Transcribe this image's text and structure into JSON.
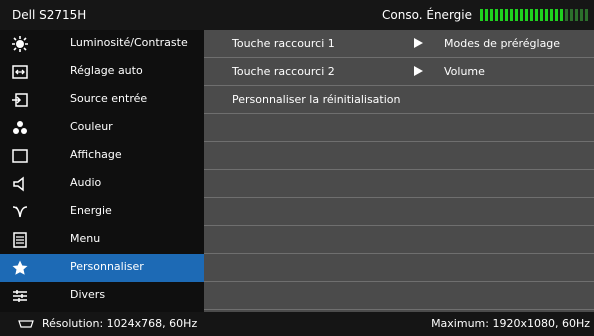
{
  "header": {
    "model": "Dell S2715H",
    "energy_label": "Conso. Énergie",
    "energy_level": 0.76,
    "energy_on_color": "#1fd21f",
    "energy_off_color": "#2c6f2c"
  },
  "menu": {
    "items": [
      {
        "label": "Luminosité/Contraste",
        "icon": "brightness-icon"
      },
      {
        "label": "Réglage auto",
        "icon": "auto-adjust-icon"
      },
      {
        "label": "Source entrée",
        "icon": "input-source-icon"
      },
      {
        "label": "Couleur",
        "icon": "color-icon"
      },
      {
        "label": "Affichage",
        "icon": "display-icon"
      },
      {
        "label": "Audio",
        "icon": "audio-icon"
      },
      {
        "label": "Energie",
        "icon": "energy-icon"
      },
      {
        "label": "Menu",
        "icon": "menu-icon"
      },
      {
        "label": "Personnaliser",
        "icon": "star-icon"
      },
      {
        "label": "Divers",
        "icon": "others-icon"
      }
    ],
    "active_index": 8
  },
  "panel": {
    "rows": [
      {
        "label": "Touche raccourci 1",
        "value": "Modes de préréglage"
      },
      {
        "label": "Touche raccourci 2",
        "value": "Volume"
      },
      {
        "label": "Personnaliser la réinitialisation",
        "value": ""
      }
    ]
  },
  "footer": {
    "resolution": "Résolution: 1024x768, 60Hz",
    "maximum": "Maximum: 1920x1080, 60Hz"
  },
  "colors": {
    "accent": "#1d6ab5",
    "panel_bg": "#4b4b4b"
  }
}
